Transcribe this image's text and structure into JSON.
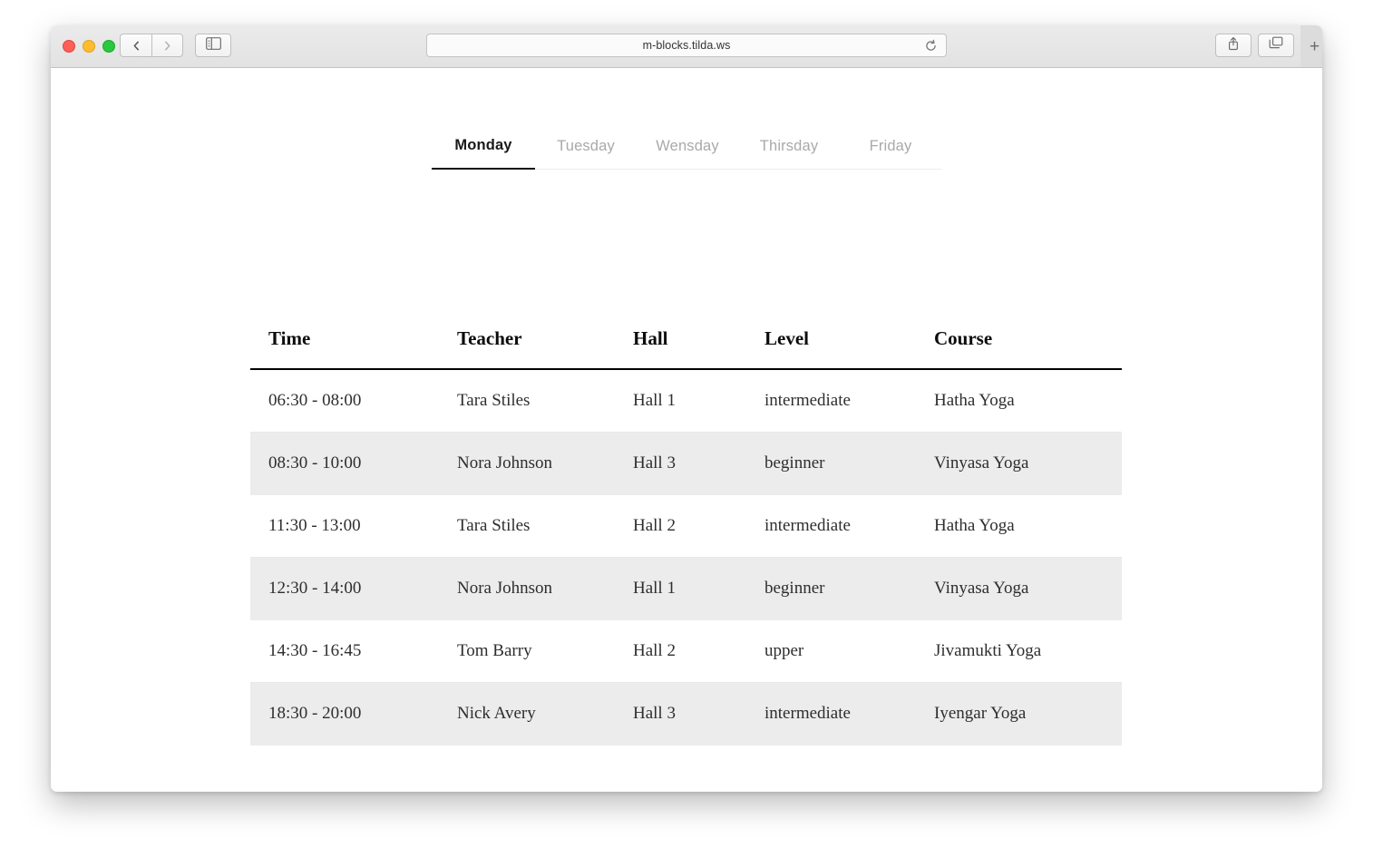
{
  "browser": {
    "url": "m-blocks.tilda.ws",
    "reload_icon": "reload-icon",
    "back_icon": "chevron-left-icon",
    "forward_icon": "chevron-right-icon",
    "sidebar_icon": "sidebar-toggle-icon",
    "share_icon": "share-icon",
    "tabs_icon": "show-tabs-icon",
    "new_tab_label": "+",
    "traffic_lights": {
      "close_color": "#ff5f57",
      "minimize_color": "#febc2e",
      "zoom_color": "#28c840"
    }
  },
  "page": {
    "day_tabs": [
      {
        "label": "Monday",
        "active": true
      },
      {
        "label": "Tuesday",
        "active": false
      },
      {
        "label": "Wensday",
        "active": false
      },
      {
        "label": "Thirsday",
        "active": false
      },
      {
        "label": "Friday",
        "active": false
      }
    ],
    "schedule": {
      "columns": [
        "Time",
        "Teacher",
        "Hall",
        "Level",
        "Course"
      ],
      "rows": [
        {
          "time": "06:30 - 08:00",
          "teacher": "Tara Stiles",
          "hall": "Hall 1",
          "level": "intermediate",
          "course": "Hatha Yoga"
        },
        {
          "time": "08:30 - 10:00",
          "teacher": "Nora Johnson",
          "hall": "Hall 3",
          "level": "beginner",
          "course": "Vinyasa Yoga"
        },
        {
          "time": "11:30 - 13:00",
          "teacher": "Tara Stiles",
          "hall": "Hall 2",
          "level": "intermediate",
          "course": "Hatha Yoga"
        },
        {
          "time": "12:30 - 14:00",
          "teacher": "Nora Johnson",
          "hall": "Hall 1",
          "level": "beginner",
          "course": "Vinyasa Yoga"
        },
        {
          "time": "14:30 - 16:45",
          "teacher": "Tom Barry",
          "hall": "Hall 2",
          "level": "upper",
          "course": "Jivamukti Yoga"
        },
        {
          "time": "18:30 - 20:00",
          "teacher": "Nick Avery",
          "hall": "Hall 3",
          "level": "intermediate",
          "course": "Iyengar Yoga"
        }
      ]
    },
    "colors": {
      "stripe_background": "#ececec",
      "header_rule": "#000000",
      "active_tab": "#111111",
      "inactive_tab": "#a9a9a9"
    }
  }
}
